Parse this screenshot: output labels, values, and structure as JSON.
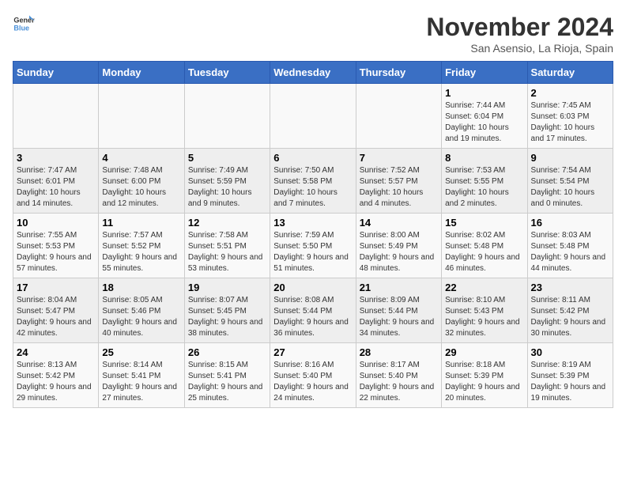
{
  "logo": {
    "text_general": "General",
    "text_blue": "Blue"
  },
  "header": {
    "month": "November 2024",
    "location": "San Asensio, La Rioja, Spain"
  },
  "days_of_week": [
    "Sunday",
    "Monday",
    "Tuesday",
    "Wednesday",
    "Thursday",
    "Friday",
    "Saturday"
  ],
  "weeks": [
    [
      {
        "day": "",
        "info": ""
      },
      {
        "day": "",
        "info": ""
      },
      {
        "day": "",
        "info": ""
      },
      {
        "day": "",
        "info": ""
      },
      {
        "day": "",
        "info": ""
      },
      {
        "day": "1",
        "info": "Sunrise: 7:44 AM\nSunset: 6:04 PM\nDaylight: 10 hours and 19 minutes."
      },
      {
        "day": "2",
        "info": "Sunrise: 7:45 AM\nSunset: 6:03 PM\nDaylight: 10 hours and 17 minutes."
      }
    ],
    [
      {
        "day": "3",
        "info": "Sunrise: 7:47 AM\nSunset: 6:01 PM\nDaylight: 10 hours and 14 minutes."
      },
      {
        "day": "4",
        "info": "Sunrise: 7:48 AM\nSunset: 6:00 PM\nDaylight: 10 hours and 12 minutes."
      },
      {
        "day": "5",
        "info": "Sunrise: 7:49 AM\nSunset: 5:59 PM\nDaylight: 10 hours and 9 minutes."
      },
      {
        "day": "6",
        "info": "Sunrise: 7:50 AM\nSunset: 5:58 PM\nDaylight: 10 hours and 7 minutes."
      },
      {
        "day": "7",
        "info": "Sunrise: 7:52 AM\nSunset: 5:57 PM\nDaylight: 10 hours and 4 minutes."
      },
      {
        "day": "8",
        "info": "Sunrise: 7:53 AM\nSunset: 5:55 PM\nDaylight: 10 hours and 2 minutes."
      },
      {
        "day": "9",
        "info": "Sunrise: 7:54 AM\nSunset: 5:54 PM\nDaylight: 10 hours and 0 minutes."
      }
    ],
    [
      {
        "day": "10",
        "info": "Sunrise: 7:55 AM\nSunset: 5:53 PM\nDaylight: 9 hours and 57 minutes."
      },
      {
        "day": "11",
        "info": "Sunrise: 7:57 AM\nSunset: 5:52 PM\nDaylight: 9 hours and 55 minutes."
      },
      {
        "day": "12",
        "info": "Sunrise: 7:58 AM\nSunset: 5:51 PM\nDaylight: 9 hours and 53 minutes."
      },
      {
        "day": "13",
        "info": "Sunrise: 7:59 AM\nSunset: 5:50 PM\nDaylight: 9 hours and 51 minutes."
      },
      {
        "day": "14",
        "info": "Sunrise: 8:00 AM\nSunset: 5:49 PM\nDaylight: 9 hours and 48 minutes."
      },
      {
        "day": "15",
        "info": "Sunrise: 8:02 AM\nSunset: 5:48 PM\nDaylight: 9 hours and 46 minutes."
      },
      {
        "day": "16",
        "info": "Sunrise: 8:03 AM\nSunset: 5:48 PM\nDaylight: 9 hours and 44 minutes."
      }
    ],
    [
      {
        "day": "17",
        "info": "Sunrise: 8:04 AM\nSunset: 5:47 PM\nDaylight: 9 hours and 42 minutes."
      },
      {
        "day": "18",
        "info": "Sunrise: 8:05 AM\nSunset: 5:46 PM\nDaylight: 9 hours and 40 minutes."
      },
      {
        "day": "19",
        "info": "Sunrise: 8:07 AM\nSunset: 5:45 PM\nDaylight: 9 hours and 38 minutes."
      },
      {
        "day": "20",
        "info": "Sunrise: 8:08 AM\nSunset: 5:44 PM\nDaylight: 9 hours and 36 minutes."
      },
      {
        "day": "21",
        "info": "Sunrise: 8:09 AM\nSunset: 5:44 PM\nDaylight: 9 hours and 34 minutes."
      },
      {
        "day": "22",
        "info": "Sunrise: 8:10 AM\nSunset: 5:43 PM\nDaylight: 9 hours and 32 minutes."
      },
      {
        "day": "23",
        "info": "Sunrise: 8:11 AM\nSunset: 5:42 PM\nDaylight: 9 hours and 30 minutes."
      }
    ],
    [
      {
        "day": "24",
        "info": "Sunrise: 8:13 AM\nSunset: 5:42 PM\nDaylight: 9 hours and 29 minutes."
      },
      {
        "day": "25",
        "info": "Sunrise: 8:14 AM\nSunset: 5:41 PM\nDaylight: 9 hours and 27 minutes."
      },
      {
        "day": "26",
        "info": "Sunrise: 8:15 AM\nSunset: 5:41 PM\nDaylight: 9 hours and 25 minutes."
      },
      {
        "day": "27",
        "info": "Sunrise: 8:16 AM\nSunset: 5:40 PM\nDaylight: 9 hours and 24 minutes."
      },
      {
        "day": "28",
        "info": "Sunrise: 8:17 AM\nSunset: 5:40 PM\nDaylight: 9 hours and 22 minutes."
      },
      {
        "day": "29",
        "info": "Sunrise: 8:18 AM\nSunset: 5:39 PM\nDaylight: 9 hours and 20 minutes."
      },
      {
        "day": "30",
        "info": "Sunrise: 8:19 AM\nSunset: 5:39 PM\nDaylight: 9 hours and 19 minutes."
      }
    ]
  ]
}
